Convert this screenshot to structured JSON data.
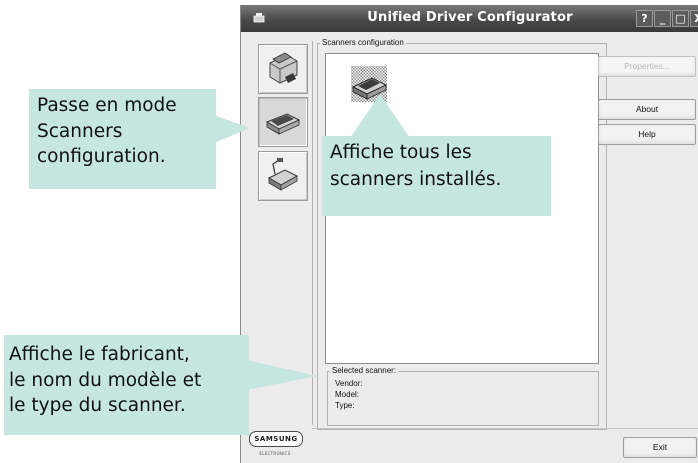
{
  "window": {
    "title": "Unified Driver Configurator",
    "controls": [
      "?",
      "_",
      "□",
      "X"
    ]
  },
  "sidebar": {
    "items": [
      {
        "name": "printers-configuration",
        "icon": "printer-icon",
        "active": false
      },
      {
        "name": "scanners-configuration",
        "icon": "scanner-icon",
        "active": true
      },
      {
        "name": "ports-configuration",
        "icon": "port-icon",
        "active": false
      }
    ]
  },
  "main": {
    "group_title": "Scanners configuration",
    "selected": {
      "title": "Selected scanner:",
      "vendor_label": "Vendor:",
      "model_label": "Model:",
      "type_label": "Type:"
    }
  },
  "buttons": {
    "properties": "Properties...",
    "about": "About",
    "help": "Help",
    "exit": "Exit"
  },
  "logo": {
    "brand": "SAMSUNG",
    "sub": "ELECTRONICS"
  },
  "callouts": {
    "mode": [
      "Passe en mode",
      "Scanners",
      "configuration."
    ],
    "list": [
      "Affiche tous les",
      "scanners installés."
    ],
    "selected": [
      "Affiche le fabricant,",
      "le nom du modèle et",
      "le type du scanner."
    ]
  },
  "colors": {
    "callout_bg": "#c6e6e0",
    "window_bg": "#ececec",
    "titlebar": "#4a4a4a"
  }
}
